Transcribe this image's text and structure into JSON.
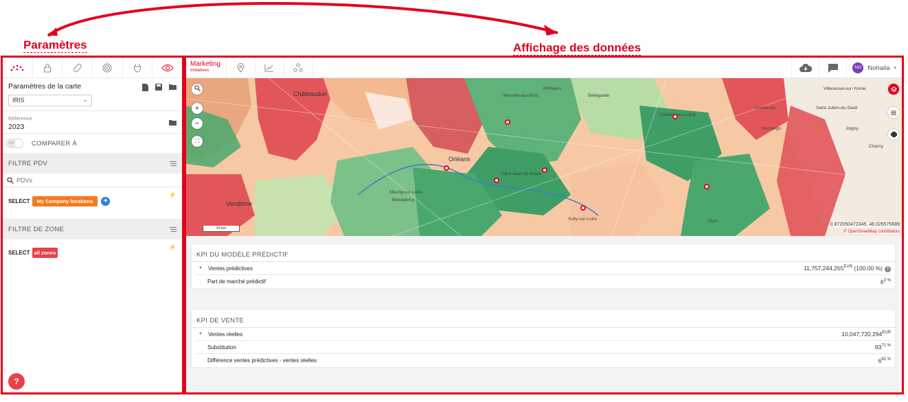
{
  "annotations": {
    "left_label": "Paramètres",
    "right_label": "Affichage des données"
  },
  "left_panel": {
    "tool_icons": [
      "dots-logo-icon",
      "lock-icon",
      "pill-icon",
      "target-icon",
      "plug-icon",
      "eye-icon"
    ],
    "map_settings_title": "Paramètres de la carte",
    "map_level_value": "IRIS",
    "reference_label": "Référence",
    "reference_value": "2023",
    "toggle_text": "OFF",
    "compare_label": "COMPARER À",
    "filter_pdv_title": "FILTRE PDV",
    "search_placeholder": "PDVs",
    "select_label": "SELECT",
    "pdv_chip": "My Company locations",
    "add_symbol": "+",
    "filter_zone_title": "FILTRE DE ZONE",
    "zone_chip": "all zones",
    "help_symbol": "?"
  },
  "right_panel": {
    "tab_title": "Marketing",
    "tab_subtitle": "Initiatives",
    "user_initials": "NO",
    "user_name": "Nohaila",
    "map": {
      "scale_label": "10 km",
      "coords": "0.872050472345, 48.026575689",
      "attribution": "© OpenStreetMap contributors",
      "cities": [
        {
          "name": "Châteaudun",
          "big": true
        },
        {
          "name": "Orléans",
          "big": true
        },
        {
          "name": "Vendôme",
          "big": true
        },
        {
          "name": "Bellegarde"
        },
        {
          "name": "Montargis"
        },
        {
          "name": "Gien"
        },
        {
          "name": "Pithiviers"
        },
        {
          "name": "Châlette-sur-Loing"
        },
        {
          "name": "Courtenay"
        },
        {
          "name": "Sully-sur-Loire"
        },
        {
          "name": "Beaugency"
        },
        {
          "name": "Meung-sur-Loire"
        },
        {
          "name": "Neuville-aux-Bois"
        },
        {
          "name": "Saint-Jean-de-Braye"
        },
        {
          "name": "Villeneuve-sur-Yonne"
        },
        {
          "name": "Joigny"
        },
        {
          "name": "Charny"
        },
        {
          "name": "Saint-Julien-du-Sault"
        }
      ]
    },
    "kpi_predictif": {
      "title": "KPI DU MODÈLE PRÉDICTIF",
      "rows": [
        {
          "label": "Ventes prédictives",
          "value": "11,757,244,255",
          "unit": "EUR",
          "extra": " (100.00 %)",
          "help": "?"
        },
        {
          "label": "Part de marché prédictif",
          "value": "6",
          "unit": "3 %"
        }
      ]
    },
    "kpi_vente": {
      "title": "KPI DE VENTE",
      "rows": [
        {
          "label": "Ventes réelles",
          "value": "10,047,720,294",
          "unit": "EUR"
        },
        {
          "label": "Substitution",
          "value": "93",
          "unit": "71 %"
        },
        {
          "label": "Différence ventes prédictives - ventes réelles",
          "value": "6",
          "unit": "62 %"
        }
      ]
    }
  },
  "colors": {
    "accent": "#e3001b",
    "orange_chip": "#f47a20",
    "red_chip": "#e8414a",
    "blue_add": "#2b7de0",
    "avatar": "#7b3fb5"
  }
}
